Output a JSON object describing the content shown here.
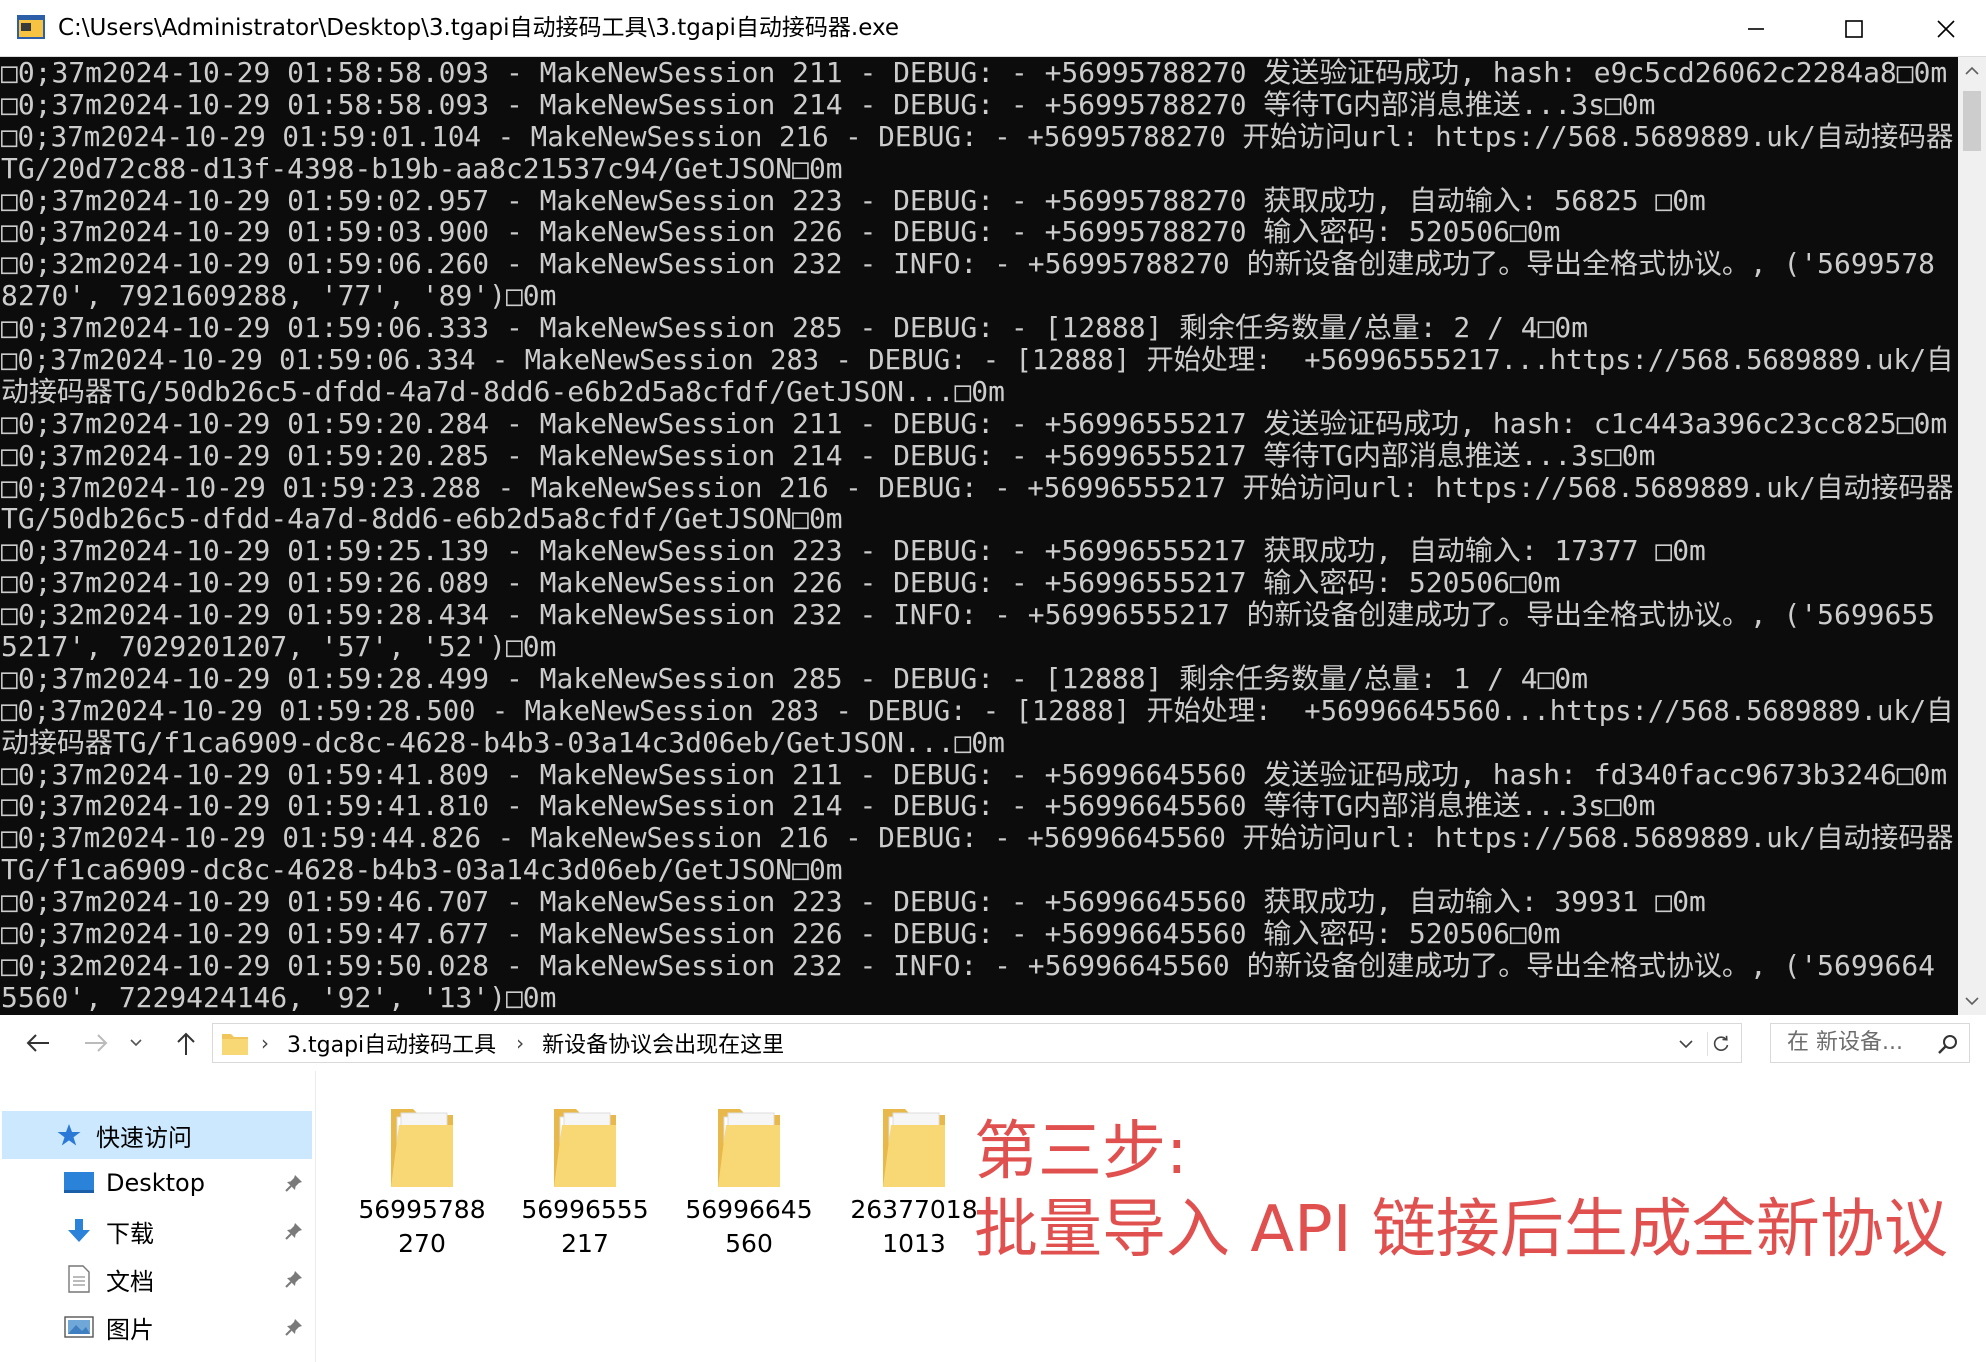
{
  "window": {
    "title": "C:\\Users\\Administrator\\Desktop\\3.tgapi自动接码工具\\3.tgapi自动接码器.exe",
    "icons": {
      "app": "console-app-icon",
      "minimize": "minimize-icon",
      "maximize": "maximize-icon",
      "close": "close-icon"
    }
  },
  "console": {
    "lines": [
      "□0;37m2024-10-29 01:58:58.093 - MakeNewSession 211 - DEBUG: - +56995788270 发送验证码成功, hash: e9c5cd26062c2284a8□0m",
      "□0;37m2024-10-29 01:58:58.093 - MakeNewSession 214 - DEBUG: - +56995788270 等待TG内部消息推送...3s□0m",
      "□0;37m2024-10-29 01:59:01.104 - MakeNewSession 216 - DEBUG: - +56995788270 开始访问url: https://568.5689889.uk/自动接码器",
      "TG/20d72c88-d13f-4398-b19b-aa8c21537c94/GetJSON□0m",
      "□0;37m2024-10-29 01:59:02.957 - MakeNewSession 223 - DEBUG: - +56995788270 获取成功, 自动输入: 56825 □0m",
      "□0;37m2024-10-29 01:59:03.900 - MakeNewSession 226 - DEBUG: - +56995788270 输入密码: 520506□0m",
      "□0;32m2024-10-29 01:59:06.260 - MakeNewSession 232 - INFO: - +56995788270 的新设备创建成功了。导出全格式协议。, ('5699578",
      "8270', 7921609288, '77', '89')□0m",
      "□0;37m2024-10-29 01:59:06.333 - MakeNewSession 285 - DEBUG: - [12888] 剩余任务数量/总量: 2 / 4□0m",
      "□0;37m2024-10-29 01:59:06.334 - MakeNewSession 283 - DEBUG: - [12888] 开始处理:  +56996555217...https://568.5689889.uk/自",
      "动接码器TG/50db26c5-dfdd-4a7d-8dd6-e6b2d5a8cfdf/GetJSON...□0m",
      "□0;37m2024-10-29 01:59:20.284 - MakeNewSession 211 - DEBUG: - +56996555217 发送验证码成功, hash: c1c443a396c23cc825□0m",
      "□0;37m2024-10-29 01:59:20.285 - MakeNewSession 214 - DEBUG: - +56996555217 等待TG内部消息推送...3s□0m",
      "□0;37m2024-10-29 01:59:23.288 - MakeNewSession 216 - DEBUG: - +56996555217 开始访问url: https://568.5689889.uk/自动接码器",
      "TG/50db26c5-dfdd-4a7d-8dd6-e6b2d5a8cfdf/GetJSON□0m",
      "□0;37m2024-10-29 01:59:25.139 - MakeNewSession 223 - DEBUG: - +56996555217 获取成功, 自动输入: 17377 □0m",
      "□0;37m2024-10-29 01:59:26.089 - MakeNewSession 226 - DEBUG: - +56996555217 输入密码: 520506□0m",
      "□0;32m2024-10-29 01:59:28.434 - MakeNewSession 232 - INFO: - +56996555217 的新设备创建成功了。导出全格式协议。, ('5699655",
      "5217', 7029201207, '57', '52')□0m",
      "□0;37m2024-10-29 01:59:28.499 - MakeNewSession 285 - DEBUG: - [12888] 剩余任务数量/总量: 1 / 4□0m",
      "□0;37m2024-10-29 01:59:28.500 - MakeNewSession 283 - DEBUG: - [12888] 开始处理:  +56996645560...https://568.5689889.uk/自",
      "动接码器TG/f1ca6909-dc8c-4628-b4b3-03a14c3d06eb/GetJSON...□0m",
      "□0;37m2024-10-29 01:59:41.809 - MakeNewSession 211 - DEBUG: - +56996645560 发送验证码成功, hash: fd340facc9673b3246□0m",
      "□0;37m2024-10-29 01:59:41.810 - MakeNewSession 214 - DEBUG: - +56996645560 等待TG内部消息推送...3s□0m",
      "□0;37m2024-10-29 01:59:44.826 - MakeNewSession 216 - DEBUG: - +56996645560 开始访问url: https://568.5689889.uk/自动接码器",
      "TG/f1ca6909-dc8c-4628-b4b3-03a14c3d06eb/GetJSON□0m",
      "□0;37m2024-10-29 01:59:46.707 - MakeNewSession 223 - DEBUG: - +56996645560 获取成功, 自动输入: 39931 □0m",
      "□0;37m2024-10-29 01:59:47.677 - MakeNewSession 226 - DEBUG: - +56996645560 输入密码: 520506□0m",
      "□0;32m2024-10-29 01:59:50.028 - MakeNewSession 232 - INFO: - +56996645560 的新设备创建成功了。导出全格式协议。, ('5699664",
      "5560', 7229424146, '92', '13')□0m"
    ],
    "colors": {
      "background": "#0c0c0c",
      "text": "#cccccc"
    }
  },
  "explorer": {
    "breadcrumb": [
      "3.tgapi自动接码工具",
      "新设备协议会出现在这里"
    ],
    "search_placeholder": "在 新设备...",
    "nav_pane": {
      "quick_access": "快速访问",
      "items": [
        "Desktop",
        "下载",
        "文档",
        "图片"
      ]
    },
    "folders": [
      {
        "line1": "56995788",
        "line2": "270"
      },
      {
        "line1": "56996555",
        "line2": "217"
      },
      {
        "line1": "56996645",
        "line2": "560"
      },
      {
        "line1": "26377018",
        "line2": "1013"
      }
    ],
    "selection_color": "#cce8ff"
  },
  "annotation": {
    "line1": "第三步:",
    "line2": "批量导入 API 链接后生成全新协议",
    "color": "#e0504f"
  }
}
